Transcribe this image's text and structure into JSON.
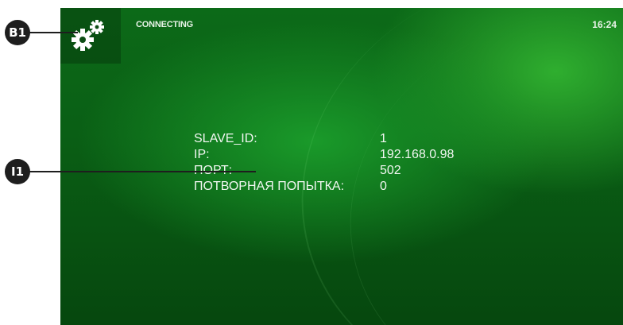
{
  "callouts": {
    "b1": "B1",
    "i1": "I1"
  },
  "topbar": {
    "status": "CONNECTING",
    "time": "16:24",
    "settings_icon": "gears-icon"
  },
  "info": {
    "rows": [
      {
        "label": "SLAVE_ID:",
        "value": "1"
      },
      {
        "label": "IP:",
        "value": "192.168.0.98"
      },
      {
        "label": "ПОРТ:",
        "value": "502"
      },
      {
        "label": "ПОТВОРНАЯ ПОПЫТКА:",
        "value": "0"
      }
    ]
  },
  "colors": {
    "background": "#0a5f15",
    "accent": "#2fae2f",
    "text": "#f2f7f2",
    "callout": "#1e1e1e"
  }
}
